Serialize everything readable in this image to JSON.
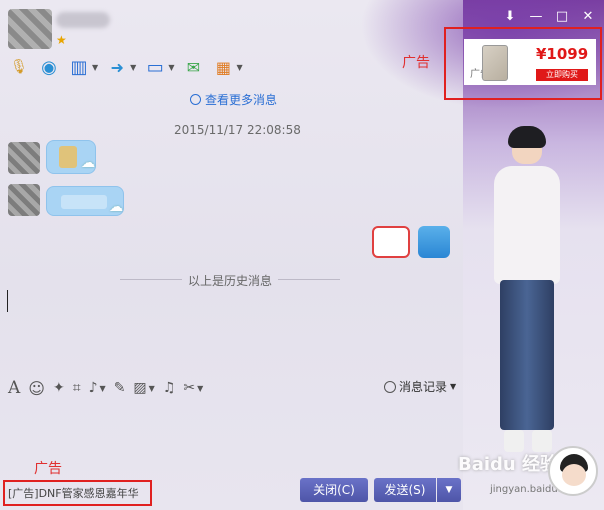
{
  "title_bar": {
    "star_icon": "star",
    "minimize": "—",
    "maximize": "□",
    "close": "✕",
    "settings": "⬇"
  },
  "toolbar": {
    "items": [
      {
        "name": "mic",
        "icon": "🎙"
      },
      {
        "name": "video",
        "icon": "◉"
      },
      {
        "name": "screen",
        "icon": "▥"
      },
      {
        "name": "file",
        "icon": "➜"
      },
      {
        "name": "remote",
        "icon": "▭"
      },
      {
        "name": "message",
        "icon": "✉"
      },
      {
        "name": "apps",
        "icon": "▦"
      }
    ]
  },
  "chat": {
    "more_messages": "查看更多消息",
    "timestamp": "2015/11/17 22:08:58",
    "history_divider": "以上是历史消息"
  },
  "input_tools": {
    "font": "A",
    "emoji": "☺",
    "magic": "✦",
    "screenshot": "⌗",
    "voice": "♪",
    "edit": "✎",
    "image": "▨",
    "music": "♫",
    "scissors": "✂"
  },
  "history_button": "消息记录",
  "buttons": {
    "close": "关闭(C)",
    "send": "发送(S)",
    "send_arrow": "▼"
  },
  "bottom_ad": {
    "text": "[广告]DNF管家感恩嘉年华",
    "label": "广告"
  },
  "top_ad": {
    "label": "广告",
    "price": "¥1099",
    "buy": "立即购买",
    "mini": "广告"
  },
  "watermark": {
    "text": "Baidu 经验",
    "url": "jingyan.baidu.com"
  }
}
